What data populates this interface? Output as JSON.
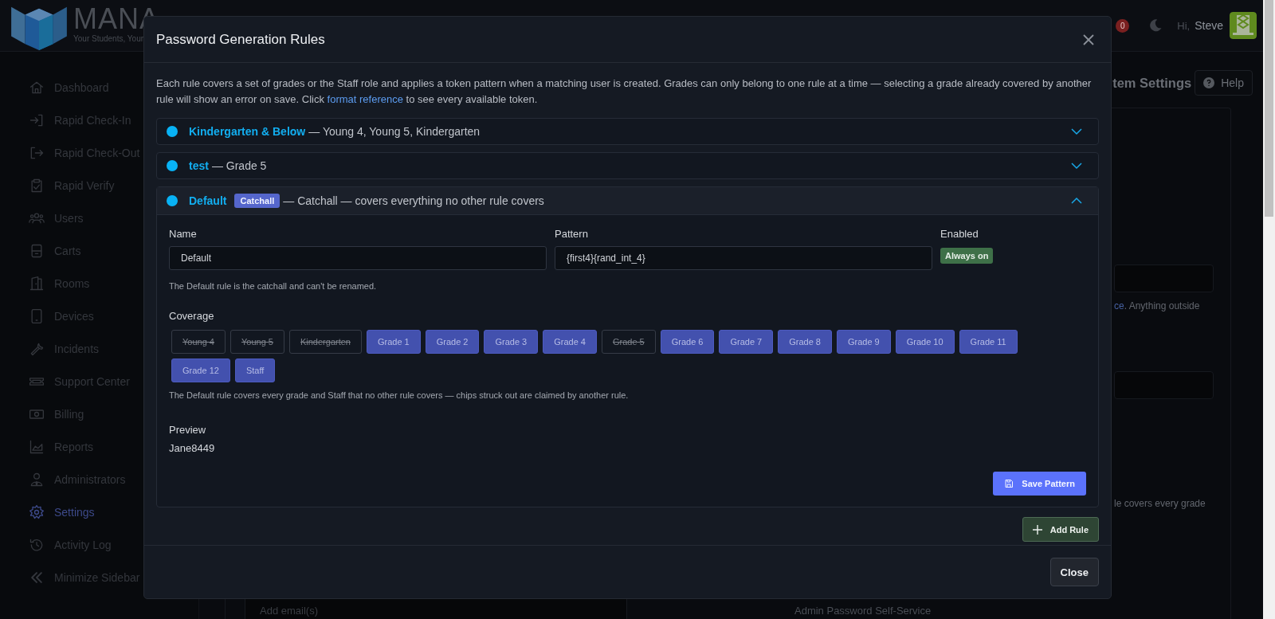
{
  "header": {
    "logo_title": "MANA",
    "logo_tagline": "Your Students, Your",
    "notification_count": "0",
    "greeting": "Hi,",
    "user_name": "Steve"
  },
  "sidebar": {
    "items": [
      {
        "label": "Dashboard",
        "selected": false
      },
      {
        "label": "Rapid Check-In",
        "selected": false
      },
      {
        "label": "Rapid Check-Out",
        "selected": false
      },
      {
        "label": "Rapid Verify",
        "selected": false
      },
      {
        "label": "Users",
        "selected": false
      },
      {
        "label": "Carts",
        "selected": false
      },
      {
        "label": "Rooms",
        "selected": false
      },
      {
        "label": "Devices",
        "selected": false
      },
      {
        "label": "Incidents",
        "selected": false
      },
      {
        "label": "Support Center",
        "selected": false
      },
      {
        "label": "Billing",
        "selected": false
      },
      {
        "label": "Reports",
        "selected": false
      },
      {
        "label": "Administrators",
        "selected": false
      },
      {
        "label": "Settings",
        "selected": true
      },
      {
        "label": "Activity Log",
        "selected": false
      },
      {
        "label": "Minimize Sidebar",
        "selected": false
      }
    ]
  },
  "main": {
    "page_title": "tem Settings",
    "help_button": "Help",
    "hint_1_link": "ce",
    "hint_1_text": ". Anything outside",
    "hint_2": "le covers every grade",
    "email_placeholder": "Add email(s)",
    "section_label": "Admin Password Self-Service"
  },
  "modal": {
    "title": "Password Generation Rules",
    "intro_before": "Each rule covers a set of grades or the Staff role and applies a token pattern when a matching user is created. Grades can only belong to one rule at a time — selecting a grade already covered by another rule will show an error on save. Click ",
    "intro_link": "format reference",
    "intro_after": " to see every available token.",
    "rules": [
      {
        "name": "Kindergarten & Below",
        "summary": "— Young 4, Young 5, Kindergarten",
        "expanded": false
      },
      {
        "name": "test",
        "summary": "— Grade 5",
        "expanded": false
      },
      {
        "name": "Default",
        "badge": "Catchall",
        "summary": "— Catchall — covers everything no other rule covers",
        "expanded": true,
        "editor": {
          "name_label": "Name",
          "name_value": "Default",
          "name_help": "The Default rule is the catchall and can't be renamed.",
          "pattern_label": "Pattern",
          "pattern_value": "{first4}{rand_int_4}",
          "enabled_label": "Enabled",
          "enabled_badge": "Always on",
          "coverage_label": "Coverage",
          "chips": [
            {
              "label": "Young 4",
              "selected": false
            },
            {
              "label": "Young 5",
              "selected": false
            },
            {
              "label": "Kindergarten",
              "selected": false
            },
            {
              "label": "Grade 1",
              "selected": true
            },
            {
              "label": "Grade 2",
              "selected": true
            },
            {
              "label": "Grade 3",
              "selected": true
            },
            {
              "label": "Grade 4",
              "selected": true
            },
            {
              "label": "Grade 5",
              "selected": false
            },
            {
              "label": "Grade 6",
              "selected": true
            },
            {
              "label": "Grade 7",
              "selected": true
            },
            {
              "label": "Grade 8",
              "selected": true
            },
            {
              "label": "Grade 9",
              "selected": true
            },
            {
              "label": "Grade 10",
              "selected": true
            },
            {
              "label": "Grade 11",
              "selected": true
            },
            {
              "label": "Grade 12",
              "selected": true
            },
            {
              "label": "Staff",
              "selected": true
            }
          ],
          "coverage_help": "The Default rule covers every grade and Staff that no other rule covers — chips struck out are claimed by another rule.",
          "preview_label": "Preview",
          "preview_value": "Jane8449",
          "save_button": "Save Pattern"
        }
      }
    ],
    "add_rule_button": "Add Rule",
    "close_button": "Close"
  }
}
